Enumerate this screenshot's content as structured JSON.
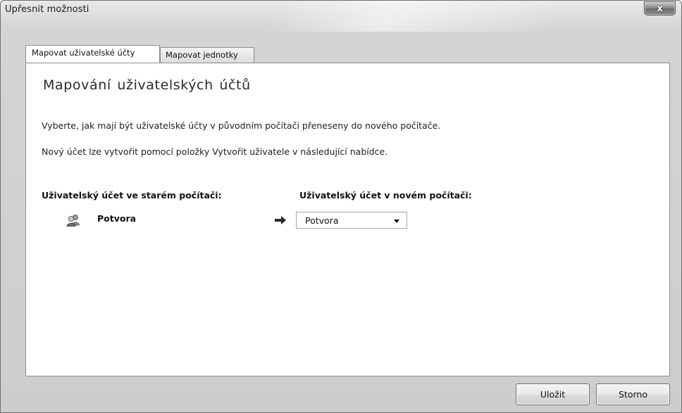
{
  "window": {
    "title": "Upřesnit možnosti",
    "close_label": "x"
  },
  "tabs": [
    {
      "label": "Mapovat uživatelské účty",
      "active": true
    },
    {
      "label": "Mapovat jednotky",
      "active": false
    }
  ],
  "main": {
    "heading": "Mapování uživatelských účtů",
    "paragraph1": "Vyberte, jak mají být uživatelské účty v původním počítači přeneseny do nového počítače.",
    "paragraph2": "Nový účet lze vytvořit pomocí položky Vytvořit uživatele v následující nabídce.",
    "old_account_label": "Uživatelský účet ve starém počítači:",
    "new_account_label": "Uživatelský účet v novém počítači:",
    "mapping": {
      "old_user": "Potvora",
      "old_user_icon": "users-icon",
      "arrow_icon": "arrow-right-icon",
      "new_user_selected": "Potvora"
    }
  },
  "buttons": {
    "save_label": "Uložit",
    "cancel_label": "Storno"
  },
  "colors": {
    "window_frame": "#d4d4d4",
    "panel_background": "#ffffff",
    "border": "#8e8e8e"
  }
}
